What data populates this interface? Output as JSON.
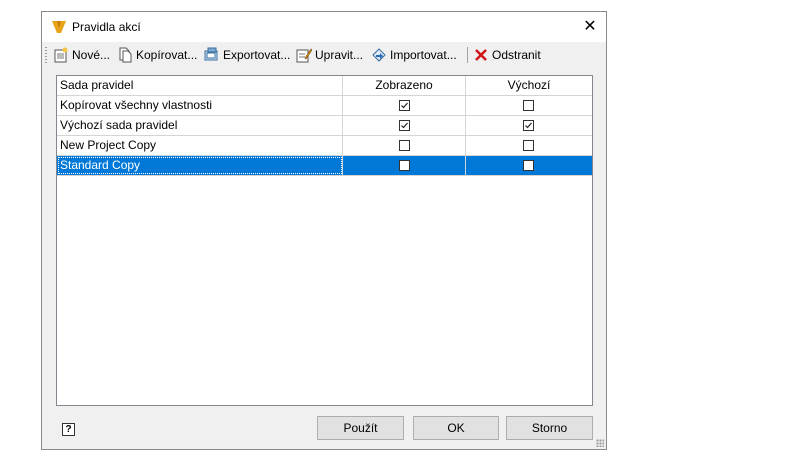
{
  "window": {
    "title": "Pravidla akcí",
    "close_glyph": "✕",
    "app_icon": "autodesk-v-icon"
  },
  "toolbar": {
    "buttons": [
      {
        "label": "Nové...",
        "icon": "new-icon"
      },
      {
        "label": "Kopírovat...",
        "icon": "copy-icon"
      },
      {
        "label": "Exportovat...",
        "icon": "export-icon"
      },
      {
        "label": "Upravit...",
        "icon": "edit-icon"
      },
      {
        "label": "Importovat...",
        "icon": "import-icon"
      },
      {
        "label": "Odstranit",
        "icon": "delete-icon"
      }
    ]
  },
  "grid": {
    "columns": [
      "Sada pravidel",
      "Zobrazeno",
      "Výchozí"
    ],
    "rows": [
      {
        "name": "Kopírovat všechny vlastnosti",
        "shown": true,
        "default": false,
        "selected": false
      },
      {
        "name": "Výchozí sada pravidel",
        "shown": true,
        "default": true,
        "selected": false
      },
      {
        "name": "New Project Copy",
        "shown": false,
        "default": false,
        "selected": false
      },
      {
        "name": "Standard Copy",
        "shown": false,
        "default": false,
        "selected": true
      }
    ]
  },
  "footer": {
    "help_glyph": "?",
    "apply_label": "Použít",
    "ok_label": "OK",
    "cancel_label": "Storno"
  },
  "colors": {
    "selection": "#0078d7",
    "button_face": "#e1e1e1",
    "dialog_bg": "#f0f0f0"
  }
}
